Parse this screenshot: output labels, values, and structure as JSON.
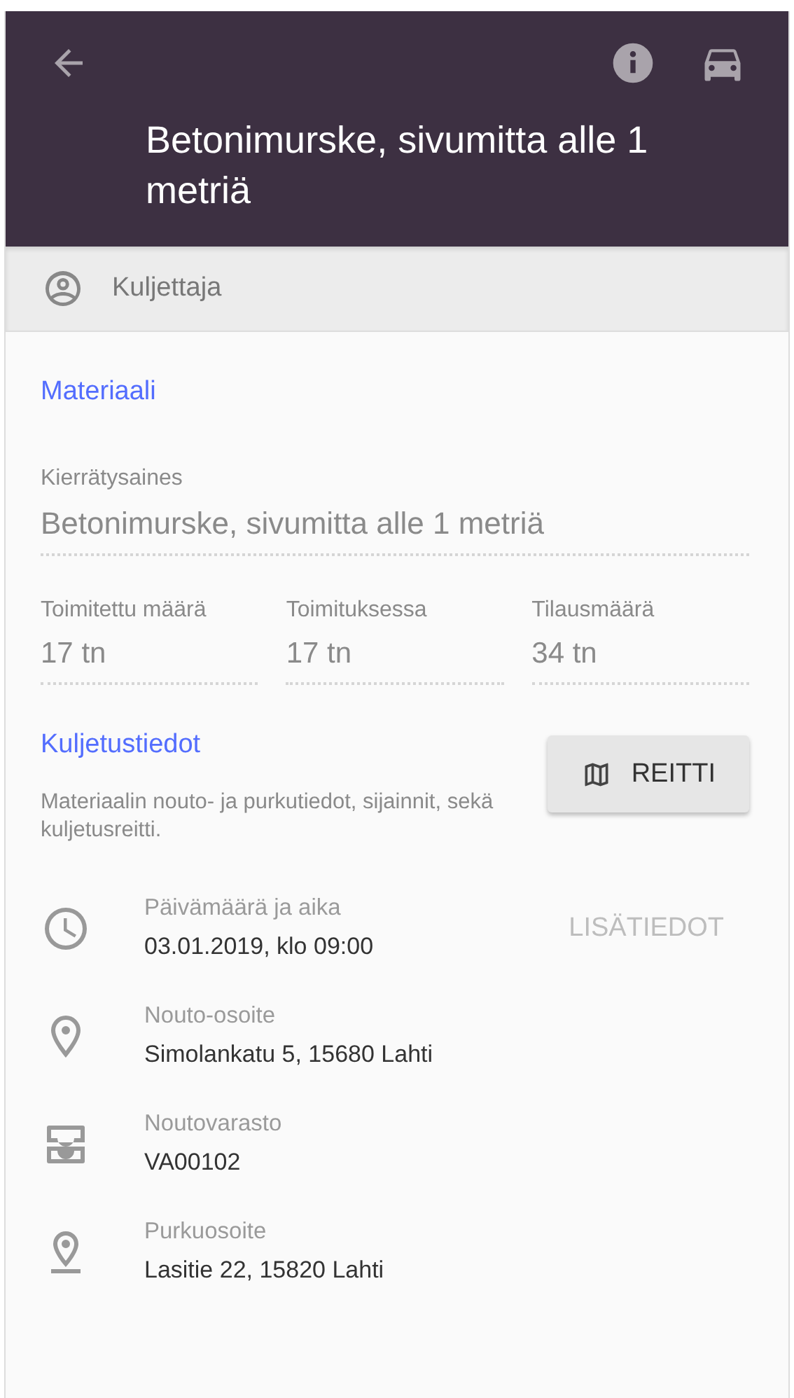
{
  "header": {
    "title": "Betonimurske, sivumitta alle 1 metriä"
  },
  "driver_bar": {
    "label": "Kuljettaja"
  },
  "material": {
    "heading": "Materiaali",
    "fields": [
      {
        "label": "Kierrätysaines",
        "value": "Betonimurske, sivumitta alle 1 metriä"
      }
    ],
    "quantities": [
      {
        "label": "Toimitettu määrä",
        "value": "17 tn"
      },
      {
        "label": "Toimituksessa",
        "value": "17 tn"
      },
      {
        "label": "Tilausmäärä",
        "value": "34 tn"
      }
    ]
  },
  "transport": {
    "heading": "Kuljetustiedot",
    "description": "Materiaalin nouto- ja purkutiedot, sijainnit, sekä kuljetusreitti.",
    "route_button": "REITTI",
    "details": [
      {
        "kind": "time",
        "label": "Päivämäärä ja aika",
        "value": "03.01.2019, klo 09:00",
        "action": {
          "label": "LISÄTIEDOT",
          "disabled": true
        }
      },
      {
        "kind": "pickup",
        "label": "Nouto-osoite",
        "value": "Simolankatu 5, 15680 Lahti"
      },
      {
        "kind": "warehouse",
        "label": "Noutovarasto",
        "value": "VA00102"
      },
      {
        "kind": "dropoff",
        "label": "Purkuosoite",
        "value": "Lasitie 22, 15820 Lahti"
      }
    ]
  }
}
